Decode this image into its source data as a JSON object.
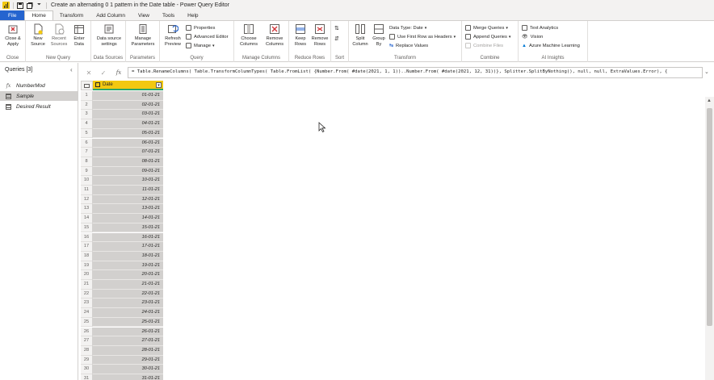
{
  "window": {
    "title": "Create an alternating 0 1 pattern in the Date table - Power Query Editor"
  },
  "ribbon_tabs": [
    "File",
    "Home",
    "Transform",
    "Add Column",
    "View",
    "Tools",
    "Help"
  ],
  "active_tab": "Home",
  "ribbon": {
    "close": {
      "btn1": "Close &\nApply",
      "label": "Close"
    },
    "new_query": {
      "new_source": "New\nSource",
      "recent_sources": "Recent\nSources",
      "enter_data": "Enter\nData",
      "label": "New Query"
    },
    "data_sources": {
      "settings": "Data source\nsettings",
      "label": "Data Sources"
    },
    "parameters": {
      "manage": "Manage\nParameters",
      "label": "Parameters"
    },
    "query": {
      "refresh": "Refresh\nPreview",
      "properties": "Properties",
      "advanced_editor": "Advanced Editor",
      "manage": "Manage",
      "label": "Query"
    },
    "manage_columns": {
      "choose": "Choose\nColumns",
      "remove": "Remove\nColumns",
      "label": "Manage Columns"
    },
    "reduce_rows": {
      "keep": "Keep\nRows",
      "remove": "Remove\nRows",
      "label": "Reduce Rows"
    },
    "sort": {
      "label": "Sort"
    },
    "transform": {
      "split": "Split\nColumn",
      "group": "Group\nBy",
      "data_type": "Data Type: Date",
      "first_row": "Use First Row as Headers",
      "replace": "Replace Values",
      "label": "Transform"
    },
    "combine": {
      "merge": "Merge Queries",
      "append": "Append Queries",
      "combine_files": "Combine Files",
      "label": "Combine"
    },
    "ai": {
      "text_analytics": "Text Analytics",
      "vision": "Vision",
      "azure_ml": "Azure Machine Learning",
      "label": "AI Insights"
    }
  },
  "queries_pane": {
    "header": "Queries [3]",
    "items": [
      {
        "name": "NumberMod",
        "icon": "function-icon"
      },
      {
        "name": "Sample",
        "icon": "table-icon",
        "selected": true
      },
      {
        "name": "Desired Result",
        "icon": "table-icon"
      }
    ]
  },
  "formula_bar": {
    "formula": "= Table.RenameColumns( Table.TransformColumnTypes( Table.FromList( {Number.From( #date(2021, 1, 1))..Number.From( #date(2021, 12, 31))}, Splitter.SplitByNothing(), null, null, ExtraValues.Error), {"
  },
  "grid": {
    "column_header": "Date",
    "rows": [
      {
        "n": "1",
        "v": "01-01-21"
      },
      {
        "n": "2",
        "v": "02-01-21"
      },
      {
        "n": "3",
        "v": "03-01-21"
      },
      {
        "n": "4",
        "v": "04-01-21"
      },
      {
        "n": "5",
        "v": "05-01-21"
      },
      {
        "n": "6",
        "v": "06-01-21"
      },
      {
        "n": "7",
        "v": "07-01-21"
      },
      {
        "n": "8",
        "v": "08-01-21"
      },
      {
        "n": "9",
        "v": "09-01-21"
      },
      {
        "n": "10",
        "v": "10-01-21"
      },
      {
        "n": "11",
        "v": "11-01-21"
      },
      {
        "n": "12",
        "v": "12-01-21"
      },
      {
        "n": "13",
        "v": "13-01-21"
      },
      {
        "n": "14",
        "v": "14-01-21"
      },
      {
        "n": "15",
        "v": "15-01-21"
      },
      {
        "n": "16",
        "v": "16-01-21"
      },
      {
        "n": "17",
        "v": "17-01-21"
      },
      {
        "n": "18",
        "v": "18-01-21"
      },
      {
        "n": "19",
        "v": "19-01-21"
      },
      {
        "n": "20",
        "v": "20-01-21"
      },
      {
        "n": "21",
        "v": "21-01-21"
      },
      {
        "n": "22",
        "v": "22-01-21"
      },
      {
        "n": "23",
        "v": "23-01-21"
      },
      {
        "n": "24",
        "v": "24-01-21"
      },
      {
        "n": "25",
        "v": "25-01-21"
      },
      {
        "n": "26",
        "v": "26-01-21"
      },
      {
        "n": "27",
        "v": "27-01-21"
      },
      {
        "n": "28",
        "v": "28-01-21"
      },
      {
        "n": "29",
        "v": "29-01-21"
      },
      {
        "n": "30",
        "v": "30-01-21"
      },
      {
        "n": "31",
        "v": "31-01-21"
      }
    ]
  },
  "colors": {
    "file_tab": "#2564cf",
    "column_header": "#f2c811",
    "column_quality": "#2ba36a"
  }
}
